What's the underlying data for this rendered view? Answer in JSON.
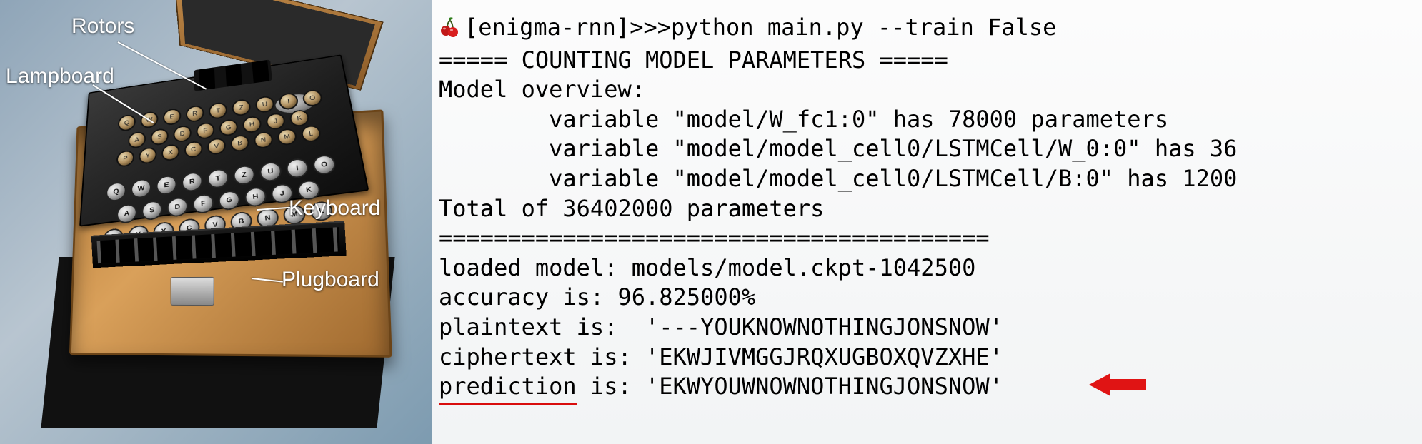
{
  "leftPanel": {
    "labels": {
      "rotors": "Rotors",
      "lampboard": "Lampboard",
      "keyboard": "Keyboard",
      "plugboard": "Plugboard"
    },
    "rows": {
      "lamp1": "QWERTZUIO",
      "lamp2": "ASDFGHJK",
      "lamp3": "PYXCVBNML",
      "key1": "QWERTZUIO",
      "key2": "ASDFGHJK",
      "key3": "PYXCVBNML"
    }
  },
  "terminal": {
    "prompt": "[enigma-rnn]>>>",
    "command": "python main.py --train False",
    "l1": "===== COUNTING MODEL PARAMETERS =====",
    "l2": "Model overview:",
    "l3": "        variable \"model/W_fc1:0\" has 78000 parameters",
    "l4": "        variable \"model/model_cell0/LSTMCell/W_0:0\" has 36",
    "l5": "        variable \"model/model_cell0/LSTMCell/B:0\" has 1200",
    "l6": "Total of 36402000 parameters",
    "l7": "========================================",
    "l8": "loaded model: models/model.ckpt-1042500",
    "l9": "accuracy is: 96.825000%",
    "l10": "plaintext is:  '---YOUKNOWNOTHINGJONSNOW'",
    "l11": "ciphertext is: 'EKWJIVMGGJRQXUGBOXQVZXHE'",
    "l12_a": "prediction",
    "l12_b": " is: 'EKWYOUWNOWNOTHINGJONSNOW'"
  }
}
